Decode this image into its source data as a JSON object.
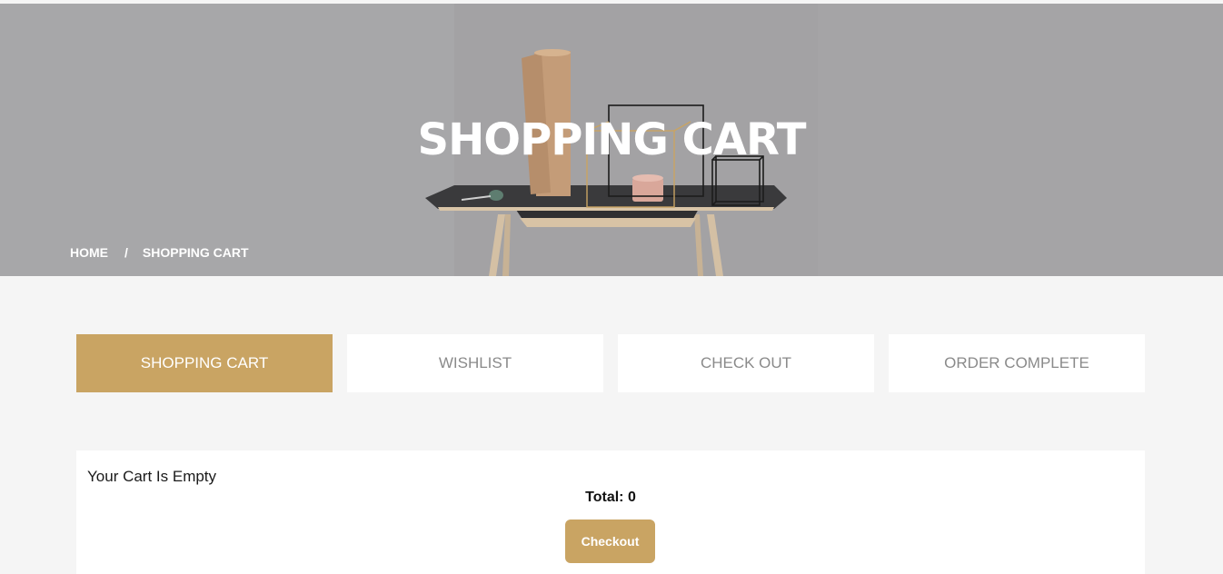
{
  "hero": {
    "title": "SHOPPING CART",
    "breadcrumb": {
      "home": "HOME",
      "separator": "/",
      "current": "SHOPPING CART"
    }
  },
  "tabs": [
    {
      "label": "SHOPPING CART",
      "active": true
    },
    {
      "label": "WISHLIST",
      "active": false
    },
    {
      "label": "CHECK OUT",
      "active": false
    },
    {
      "label": "ORDER COMPLETE",
      "active": false
    }
  ],
  "cart": {
    "empty_message": "Your Cart Is Empty",
    "total_label": "Total: 0",
    "checkout_label": "Checkout"
  },
  "colors": {
    "accent": "#c9a463",
    "page_background": "#f5f5f5",
    "tab_inactive_text": "#8a8a8a"
  }
}
